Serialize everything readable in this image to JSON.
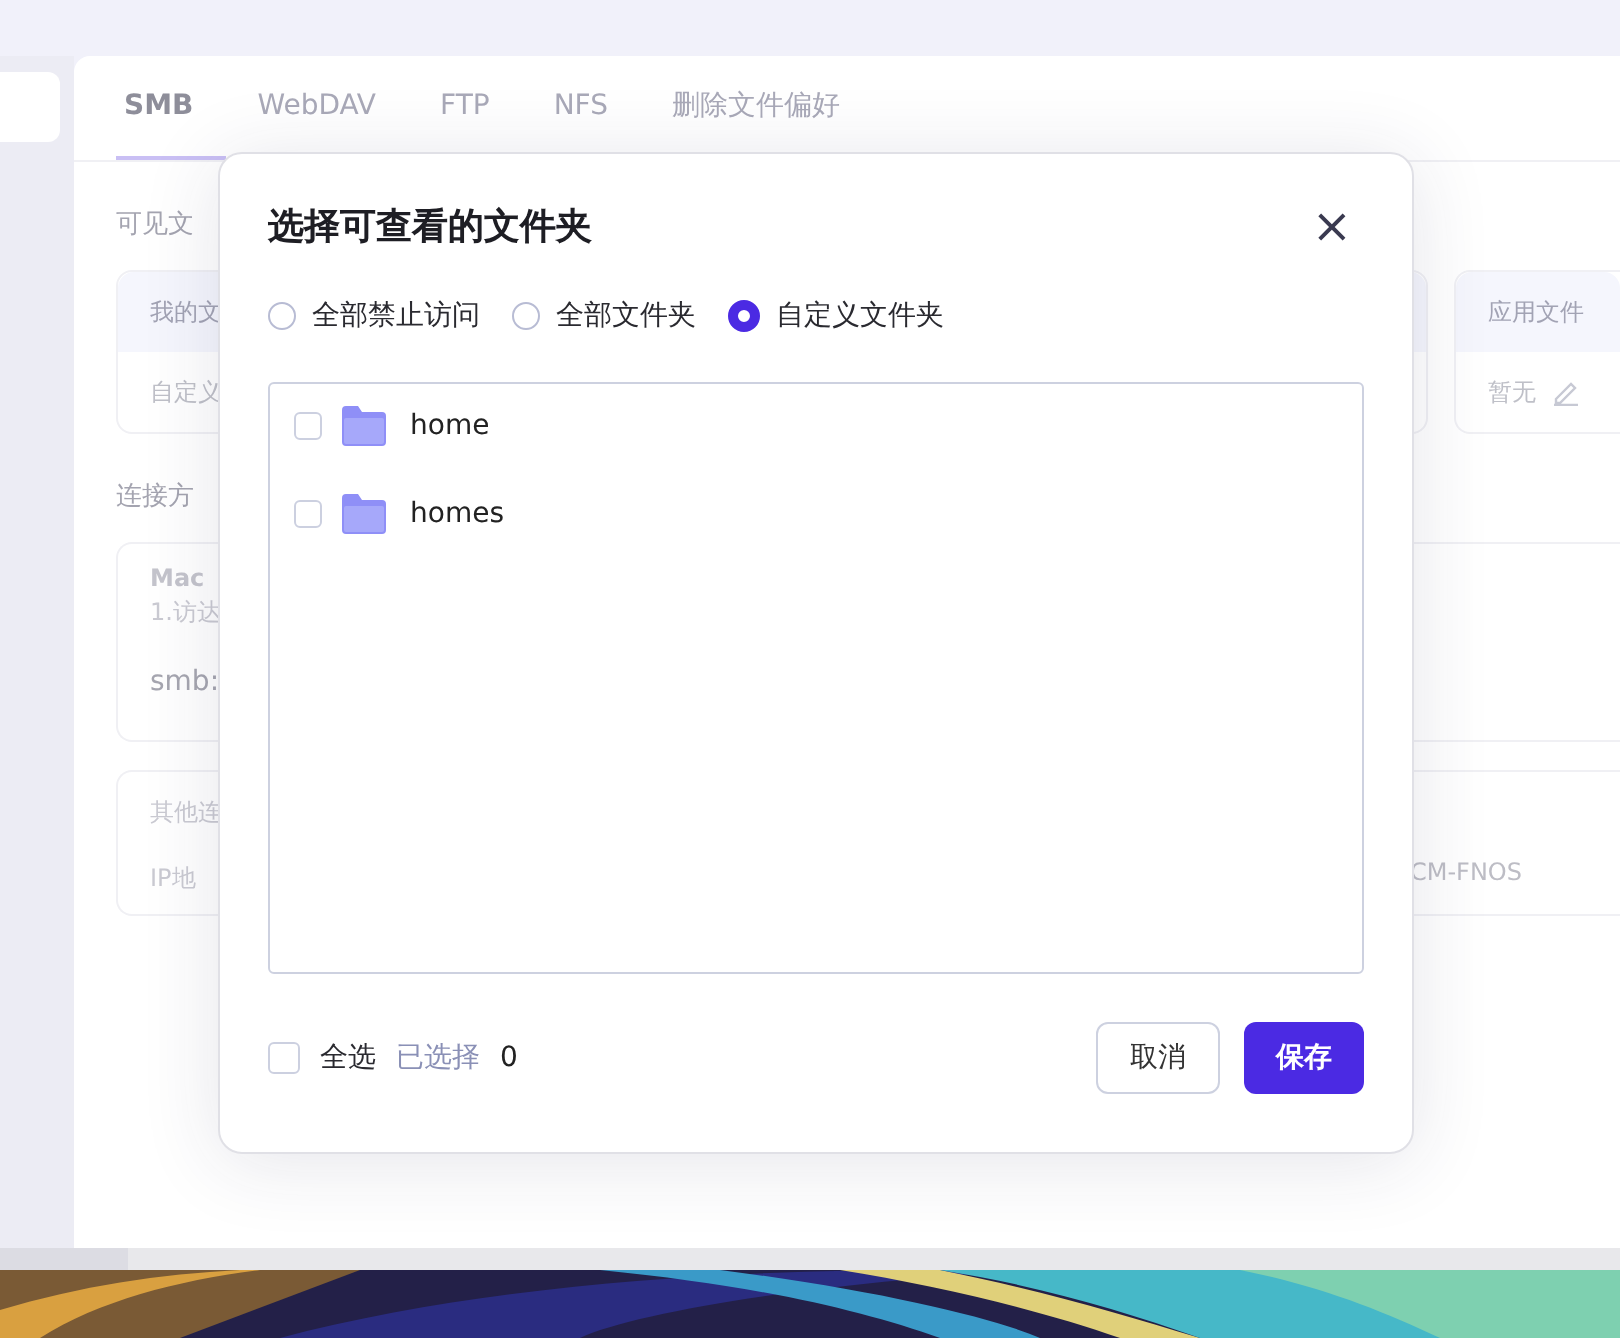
{
  "tabs": [
    {
      "label": "SMB",
      "selected": true
    },
    {
      "label": "WebDAV",
      "selected": false
    },
    {
      "label": "FTP",
      "selected": false
    },
    {
      "label": "NFS",
      "selected": false
    },
    {
      "label": "删除文件偏好",
      "selected": false
    }
  ],
  "background": {
    "visible_title": "可见文",
    "my_card": {
      "header": "我的文",
      "value": "自定义"
    },
    "app_card": {
      "header": "应用文件",
      "value": "暂无"
    },
    "connect_title": "连接方",
    "mac_card": {
      "title": "Mac",
      "step": "1.访达",
      "address": "smb:"
    },
    "other_card": {
      "title": "其他连",
      "ip_label": "IP地",
      "host": "CM-FNOS"
    }
  },
  "dialog": {
    "title": "选择可查看的文件夹",
    "close": "×",
    "options": [
      {
        "label": "全部禁止访问",
        "selected": false
      },
      {
        "label": "全部文件夹",
        "selected": false
      },
      {
        "label": "自定义文件夹",
        "selected": true
      }
    ],
    "folders": [
      {
        "name": "home",
        "checked": false
      },
      {
        "name": "homes",
        "checked": false
      }
    ],
    "select_all": {
      "label": "全选",
      "checked": false
    },
    "selected_label": "已选择",
    "selected_count": "0",
    "buttons": [
      {
        "label": "取消",
        "kind": "secondary"
      },
      {
        "label": "保存",
        "kind": "primary"
      }
    ]
  }
}
